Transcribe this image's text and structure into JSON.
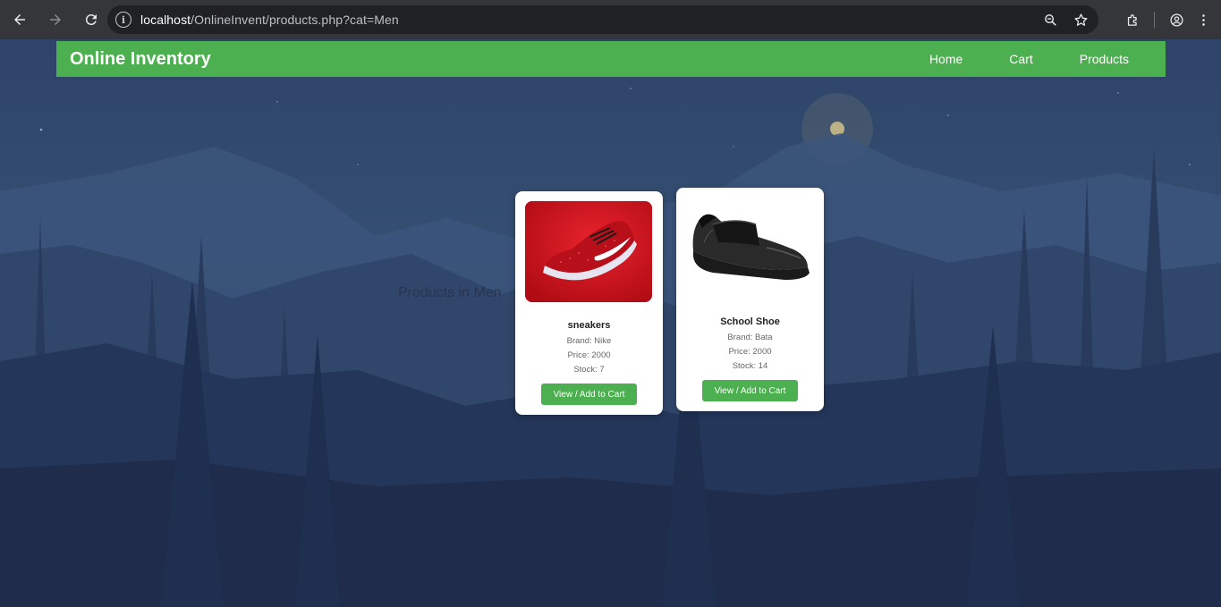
{
  "browser": {
    "url_host": "localhost",
    "url_path": "/OnlineInvent/products.php?cat=Men"
  },
  "navbar": {
    "brand": "Online Inventory",
    "links": [
      "Home",
      "Cart",
      "Products"
    ],
    "color": "#4caf50"
  },
  "main": {
    "heading": "Products in Men",
    "products": [
      {
        "name": "sneakers",
        "brand": "Brand: Nike",
        "price": "Price: 2000",
        "stock": "Stock: 7",
        "button": "View / Add to Cart",
        "image": "red-sneaker"
      },
      {
        "name": "School Shoe",
        "brand": "Brand: Bata",
        "price": "Price: 2000",
        "stock": "Stock: 14",
        "button": "View / Add to Cart",
        "image": "black-school-shoe"
      }
    ]
  }
}
